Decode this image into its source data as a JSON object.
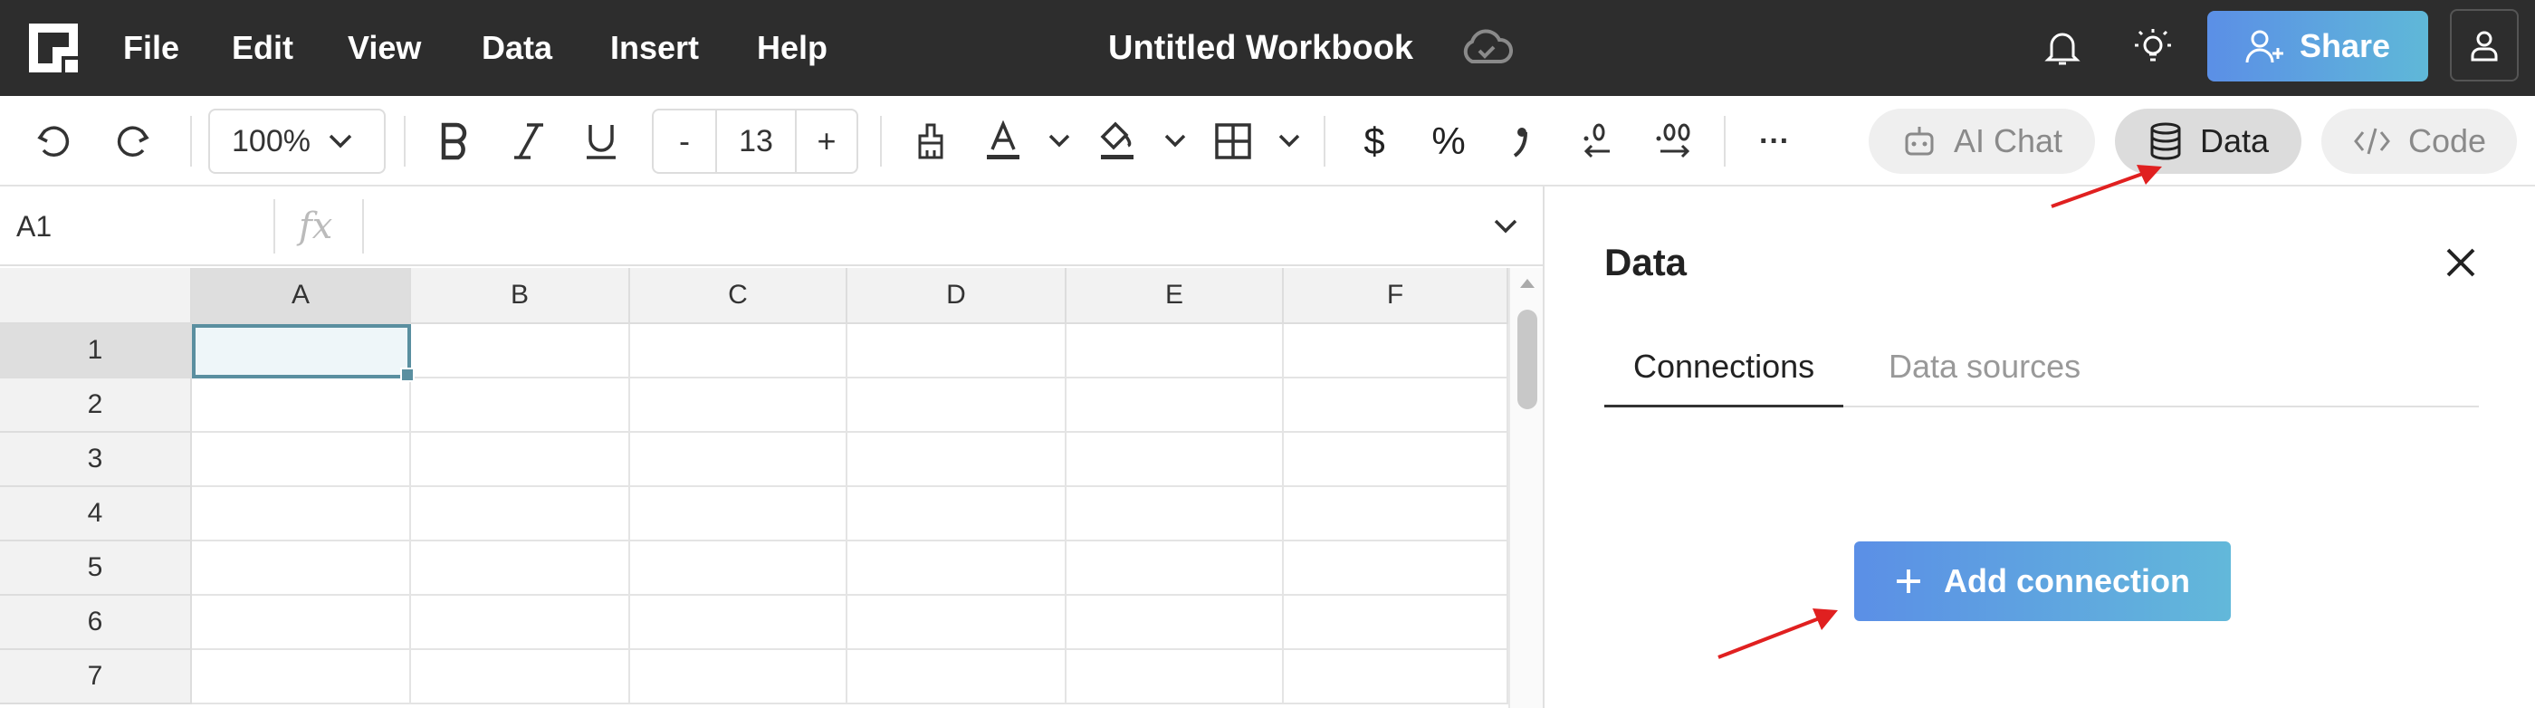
{
  "app": {
    "menu": [
      "File",
      "Edit",
      "View",
      "Data",
      "Insert",
      "Help"
    ],
    "title": "Untitled Workbook",
    "share_label": "Share"
  },
  "toolbar": {
    "zoom": "100%",
    "font_size": "13",
    "decrease_label": "-",
    "increase_label": "+",
    "currency_symbol": "$",
    "percent_symbol": "%",
    "more_label": "···",
    "modes": [
      {
        "label": "AI Chat",
        "icon": "robot-icon",
        "active": false
      },
      {
        "label": "Data",
        "icon": "database-icon",
        "active": true
      },
      {
        "label": "Code",
        "icon": "code-icon",
        "active": false
      }
    ]
  },
  "formula_bar": {
    "cell_ref": "A1",
    "fx_label": "fx",
    "value": ""
  },
  "sheet": {
    "columns": [
      "A",
      "B",
      "C",
      "D",
      "E",
      "F"
    ],
    "rows": [
      "1",
      "2",
      "3",
      "4",
      "5",
      "6",
      "7"
    ],
    "selected_cell": "A1"
  },
  "data_panel": {
    "title": "Data",
    "tabs": [
      {
        "label": "Connections",
        "active": true
      },
      {
        "label": "Data sources",
        "active": false
      }
    ],
    "add_button_label": "Add connection"
  },
  "colors": {
    "topbar": "#2d2d2d",
    "accent_start": "#5b8fe6",
    "accent_end": "#62b8da",
    "selection": "#5a8fa0",
    "annotation": "#e02020"
  }
}
